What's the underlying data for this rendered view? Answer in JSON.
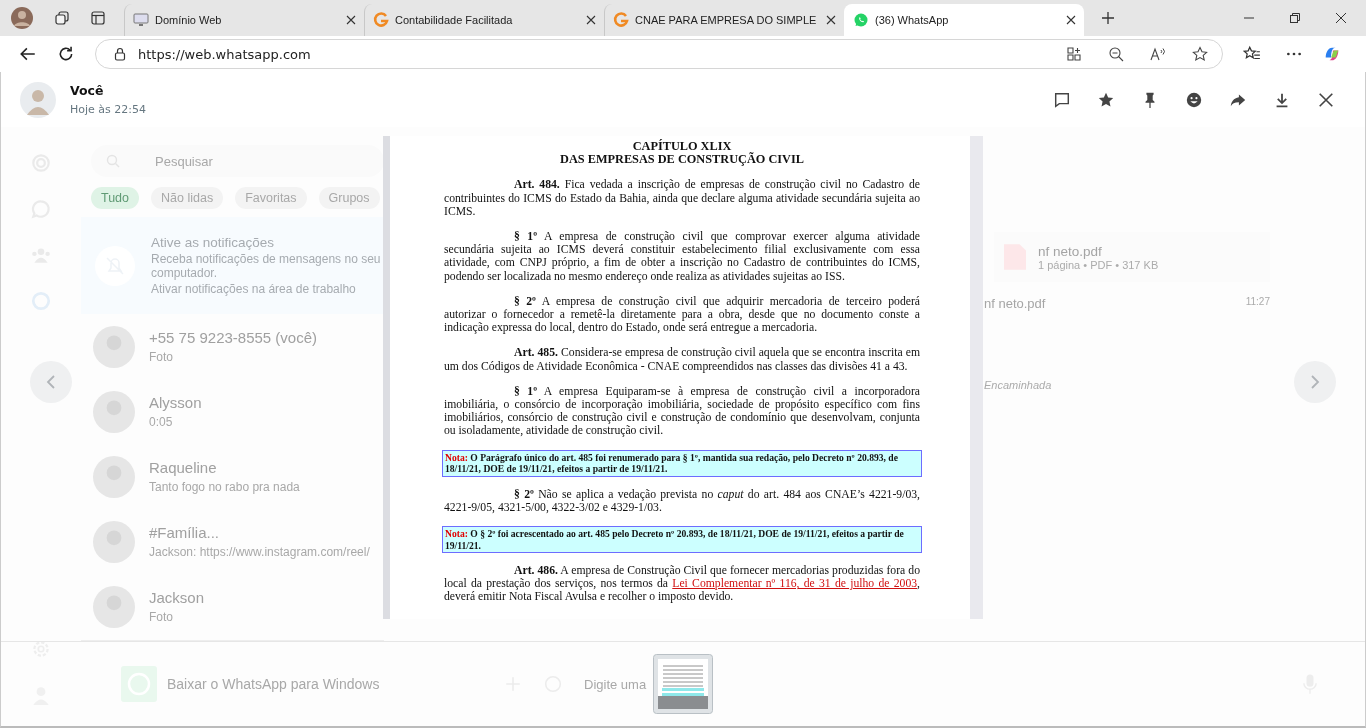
{
  "browser": {
    "tabs": [
      {
        "title": "Domínio Web",
        "selected": false
      },
      {
        "title": "Contabilidade Facilitada",
        "selected": false
      },
      {
        "title": "CNAE PARA EMPRESA DO SIMPLE",
        "selected": false
      },
      {
        "title": "(36) WhatsApp",
        "selected": true
      }
    ],
    "url": "https://web.whatsapp.com"
  },
  "background": {
    "search": {
      "placeholder": "Pesquisar"
    },
    "filters": [
      {
        "label": "Tudo",
        "selected": true
      },
      {
        "label": "Não lidas",
        "selected": false
      },
      {
        "label": "Favoritas",
        "selected": false
      },
      {
        "label": "Grupos",
        "selected": false
      }
    ],
    "notice": {
      "title": "Ative as notificações",
      "text": "Receba notificações de mensagens no seu computador.",
      "link": "Ativar notificações na área de trabalho"
    },
    "chats": [
      {
        "name": "+55 75 9223-8555 (você)",
        "preview": "Foto"
      },
      {
        "name": "Alysson",
        "preview": "0:05"
      },
      {
        "name": "Raqueline",
        "preview": "Tanto fogo no rabo pra nada"
      },
      {
        "name": "#Família...",
        "preview": "Jackson: https://www.instagram.com/reel/"
      },
      {
        "name": "Jackson",
        "preview": "Foto"
      }
    ],
    "download_banner": "Baixar o WhatsApp para Windows",
    "file": {
      "name": "nf neto.pdf",
      "meta": "1 página • PDF • 317 KB",
      "caption": "nf neto.pdf",
      "time": "11:27"
    },
    "forwarded": "Encaminhada",
    "composer": {
      "placeholder": "Digite uma"
    }
  },
  "viewer": {
    "sender": "Você",
    "time": "Hoje às 22:54",
    "document": {
      "heading": [
        "CAPÍTULO XLIX",
        "DAS EMPRESAS DE CONSTRUÇÃO CIVIL"
      ],
      "blocks": [
        {
          "kind": "paragraph",
          "lead": "Art. 484.",
          "text": "Fica vedada a inscrição de empresas de construção civil no Cadastro de contribuintes do ICMS do Estado da Bahia, ainda que declare alguma atividade secundária sujeita ao ICMS."
        },
        {
          "kind": "paragraph",
          "lead": "§ 1º",
          "text": "A empresa de construção civil que comprovar exercer alguma atividade secundária sujeita ao ICMS deverá constituir estabelecimento filial exclusivamente com essa atividade, com CNPJ próprio, a fim de obter a inscrição no Cadastro de contribuintes do ICMS, podendo ser localizada no mesmo endereço onde realiza as atividades sujeitas ao ISS."
        },
        {
          "kind": "paragraph",
          "lead": "§ 2º",
          "text": "A empresa de construção civil que adquirir mercadoria de terceiro poderá autorizar o fornecedor a remetê-la diretamente para a obra, desde que no documento conste a indicação expressa do local, dentro do Estado, onde será entregue a mercadoria."
        },
        {
          "kind": "paragraph",
          "lead": "Art. 485.",
          "text": "Considera-se empresa de construção civil aquela que se encontra inscrita em um dos Códigos de Atividade Econômica - CNAE compreendidos nas classes das divisões 41 a 43."
        },
        {
          "kind": "paragraph",
          "lead": "§ 1º",
          "text": "A empresa Equiparam-se à empresa de construção civil a incorporadora imobiliária, o consórcio de incorporação imobiliária, sociedade de propósito específico com fins imobiliários, consórcio de construção civil e construção de condomínio que desenvolvam, conjunta ou isoladamente, atividade de construção civil."
        },
        {
          "kind": "note",
          "label": "Nota:",
          "text": "O Parágrafo único do art. 485 foi renumerado para § 1º, mantida sua redação, pelo Decreto nº 20.893, de 18/11/21, DOE de 19/11/21, efeitos a partir de 19/11/21."
        },
        {
          "kind": "paragraph",
          "lead": "§ 2º",
          "text": "Não se aplica a vedação prevista no *caput* do art. 484 aos CNAE’s 4221-9/03, 4221-9/05, 4321-5/00, 4322-3/02 e 4329-1/03."
        },
        {
          "kind": "note",
          "label": "Nota:",
          "text": "O § 2º foi acrescentado ao art. 485 pelo Decreto nº 20.893, de 18/11/21, DOE de 19/11/21, efeitos a partir de 19/11/21."
        },
        {
          "kind": "linked",
          "lead": "Art. 486.",
          "text": "A empresa de Construção Civil que fornecer mercadorias produzidas fora do local da prestação dos serviços, nos termos da",
          "link": "Lei Complementar nº 116, de 31 de julho de 2003",
          "after": ", deverá emitir Nota Fiscal Avulsa e recolher o imposto devido."
        }
      ]
    }
  }
}
